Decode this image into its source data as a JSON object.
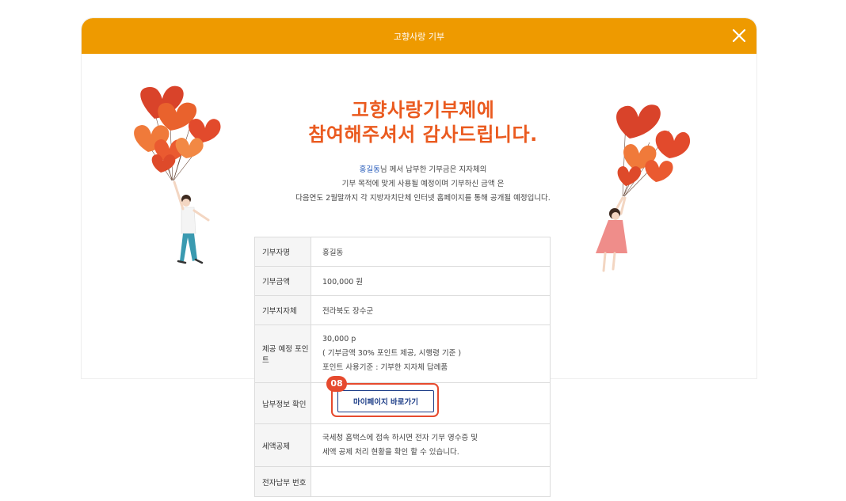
{
  "modal": {
    "title": "고향사랑 기부",
    "close_icon": "close-icon"
  },
  "headline": {
    "line1": "고향사랑기부제에",
    "line2": "참여해주셔서 감사드립니다."
  },
  "message": {
    "donor_name": "홍길동",
    "line1_rest": "님 께서 납부한 기부금은 지자체의",
    "line2": "기부 목적에 맞게 사용될 예정이며 기부하신 금액 은",
    "line3": "다음연도 2월말까지 각 지방자치단체 인터넷 홈페이지를 통해 공개될 예정입니다."
  },
  "table": {
    "rows": [
      {
        "label": "기부자명",
        "value": "홍길동"
      },
      {
        "label": "기부금액",
        "value": "100,000 원"
      },
      {
        "label": "기부지자체",
        "value": "전라북도 장수군"
      },
      {
        "label": "제공 예정 포인트",
        "lines": [
          "30,000 p",
          "( 기부금액 30% 포인트 제공, 시행령 기준 )",
          "포인트 사용기준 : 기부한 지자체 답례품"
        ]
      },
      {
        "label": "납부정보 확인",
        "button": "마이페이지 바로가기"
      },
      {
        "label": "세액공제",
        "lines": [
          "국세청 홈택스에 접속 하시면 전자 기부 영수증 및",
          "세액 공제 처리 현황을 확인 할 수 있습니다."
        ]
      },
      {
        "label": "전자납부 번호",
        "value": ""
      }
    ]
  },
  "step_badge": "08",
  "colors": {
    "header": "#ee9a00",
    "headline": "#ea5a1f",
    "highlight": "#e64a2e",
    "button_border": "#1b3c87",
    "donor_name": "#1f56b8"
  }
}
